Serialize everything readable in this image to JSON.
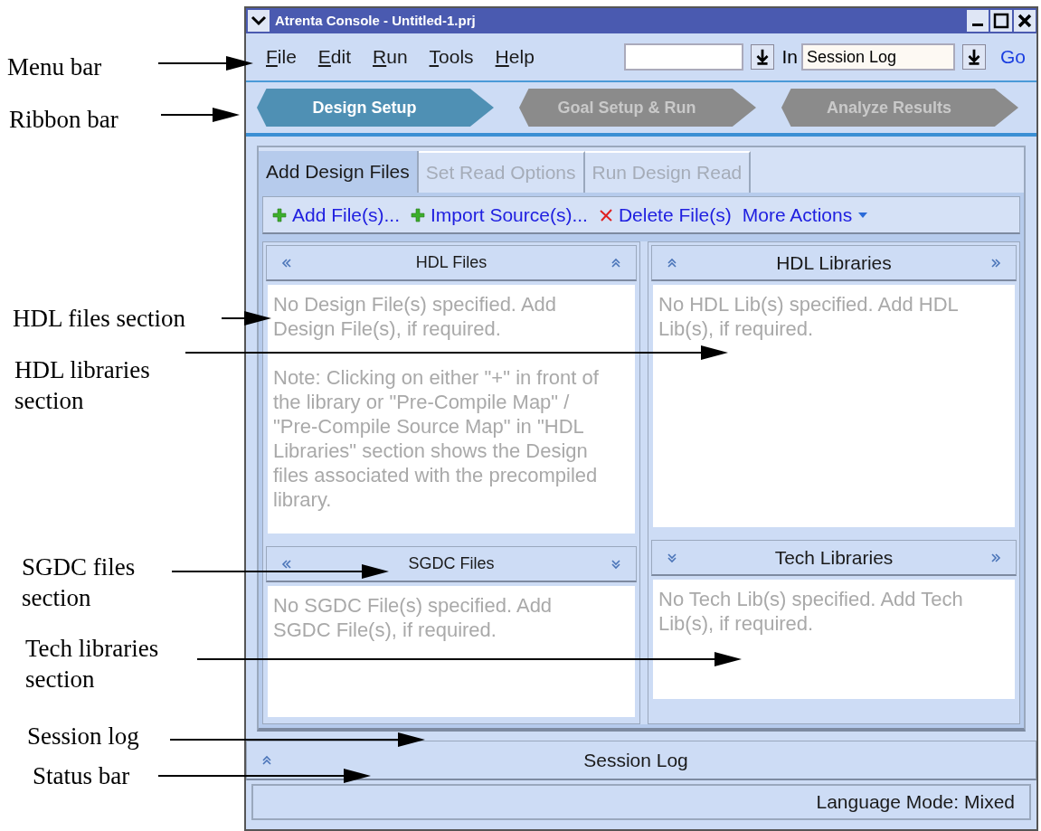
{
  "annotations": [
    {
      "label": "Menu bar"
    },
    {
      "label": "Ribbon bar"
    },
    {
      "label": "HDL files section"
    },
    {
      "label": "HDL libraries section"
    },
    {
      "label": "SGDC files section"
    },
    {
      "label": "Tech libraries section"
    },
    {
      "label": "Session log"
    },
    {
      "label": "Status bar"
    }
  ],
  "window": {
    "title": "Atrenta Console - Untitled-1.prj"
  },
  "menu": [
    "File",
    "Edit",
    "Run",
    "Tools",
    "Help"
  ],
  "search": {
    "in_label": "In",
    "scope": "Session Log",
    "go": "Go"
  },
  "ribbon": [
    {
      "label": "Design Setup",
      "selected": true
    },
    {
      "label": "Goal Setup & Run",
      "selected": false
    },
    {
      "label": "Analyze Results",
      "selected": false
    }
  ],
  "tabs": [
    {
      "label": "Add Design Files",
      "selected": true
    },
    {
      "label": "Set Read Options",
      "selected": false
    },
    {
      "label": "Run Design Read",
      "selected": false
    }
  ],
  "actions": [
    {
      "kind": "add",
      "label": "Add File(s)..."
    },
    {
      "kind": "add",
      "label": "Import Source(s)..."
    },
    {
      "kind": "delete",
      "label": "Delete File(s)"
    },
    {
      "kind": "menu",
      "label": "More Actions"
    }
  ],
  "columns": [
    [
      {
        "title": "HDL Files",
        "messages": [
          "No Design File(s) specified. Add Design File(s), if required.",
          "Note: Clicking on either \"+\" in front of the library or \"Pre-Compile Map\" / \"Pre-Compile Source Map\" in \"HDL Libraries\" section shows the Design files associated with the precompiled library."
        ]
      },
      {
        "title": "SGDC Files",
        "messages": [
          "No SGDC File(s) specified. Add SGDC File(s), if required."
        ]
      }
    ],
    [
      {
        "title": "HDL Libraries",
        "messages": [
          "No HDL Lib(s) specified. Add HDL Lib(s), if required."
        ]
      },
      {
        "title": "Tech Libraries",
        "messages": [
          "No Tech Lib(s) specified. Add Tech Lib(s), if required."
        ]
      }
    ]
  ],
  "session_log": {
    "title": "Session Log"
  },
  "status_bar": "Language Mode: Mixed"
}
